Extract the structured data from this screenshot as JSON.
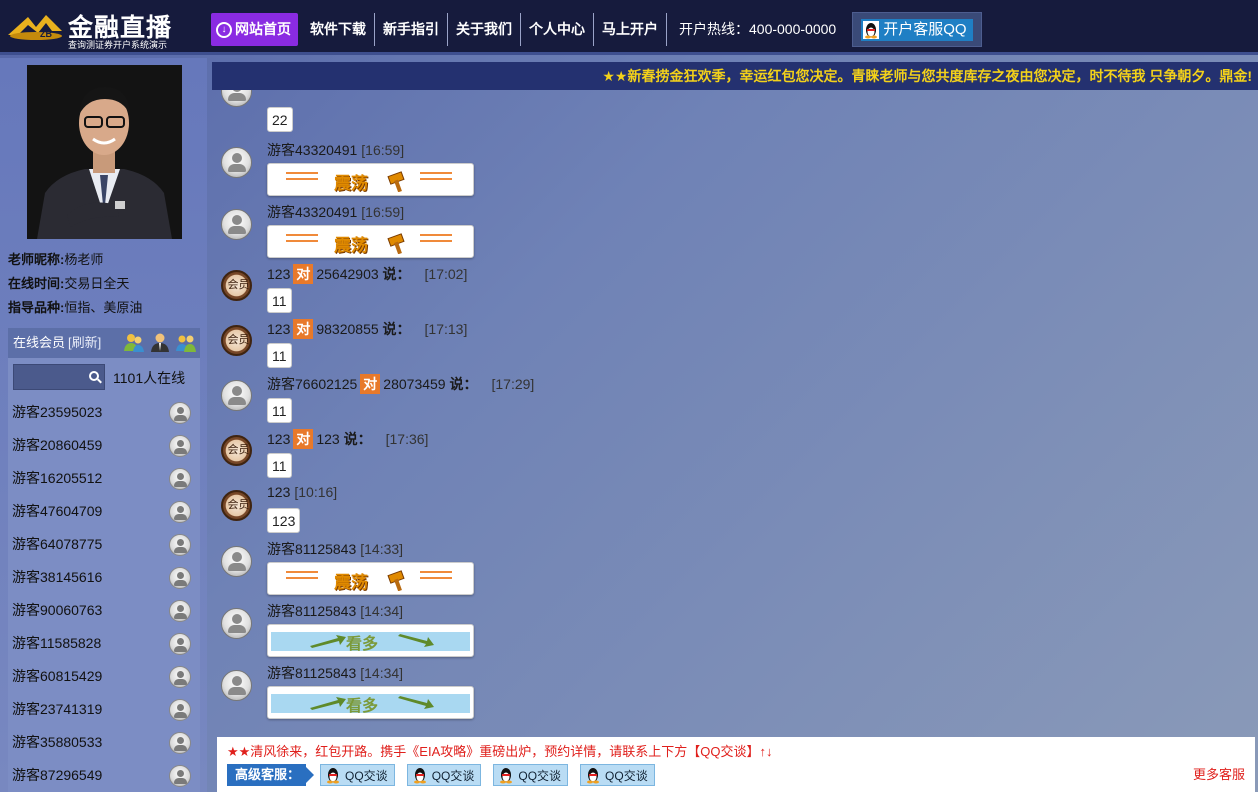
{
  "brand": {
    "title": "金融直播",
    "subtitle": "查询测证券开户系统演示"
  },
  "nav": {
    "items": [
      "网站首页",
      "软件下载",
      "新手指引",
      "关于我们",
      "个人中心",
      "马上开户"
    ],
    "hotline": "开户热线：400-000-0000",
    "qq_button": "开户客服QQ"
  },
  "teacher": {
    "nickname_label": "老师昵称:",
    "nickname": "杨老师",
    "online_label": "在线时间:",
    "online": "交易日全天",
    "products_label": "指导品种:",
    "products": "恒指、美原油"
  },
  "members": {
    "title": "在线会员",
    "refresh": "[刷新]",
    "search_placeholder": "",
    "online_count": "1101人在线",
    "list": [
      "游客23595023",
      "游客20860459",
      "游客16205512",
      "游客47604709",
      "游客64078775",
      "游客38145616",
      "游客90060763",
      "游客11585828",
      "游客60815429",
      "游客23741319",
      "游客35880533",
      "游客87296549"
    ]
  },
  "marquee": "★★新春捞金狂欢季，幸运红包您决定。青睐老师与您共度库存之夜由您决定，时不待我 只争朝夕。鼎金!",
  "chat": {
    "member_badge": "会员",
    "to_label": "对",
    "say_label": "说：",
    "messages": [
      {
        "text": "22"
      },
      {
        "user": "游客43320491",
        "time": "[16:59]",
        "sticker": "震荡"
      },
      {
        "user": "游客43320491",
        "time": "[16:59]",
        "sticker": "震荡"
      },
      {
        "user": "123",
        "target": "25642903",
        "time": "[17:02]",
        "text": "11"
      },
      {
        "user": "123",
        "target": "98320855",
        "time": "[17:13]",
        "text": "11"
      },
      {
        "user": "游客76602125",
        "target": "28073459",
        "time": "[17:29]",
        "text": "11"
      },
      {
        "user": "123",
        "target": "123",
        "time": "[17:36]",
        "text": "11"
      },
      {
        "user": "123",
        "time": "[10:16]",
        "text": "123"
      },
      {
        "user": "游客81125843",
        "time": "[14:33]",
        "sticker": "震荡"
      },
      {
        "user": "游客81125843",
        "time": "[14:34]",
        "sticker": "看多"
      },
      {
        "user": "游客81125843",
        "time": "[14:34]",
        "sticker": "看多"
      }
    ]
  },
  "bottom": {
    "notice": "★★清风徐来，红包开路。携手《EIA攻略》重磅出炉，预约详情，请联系上下方【QQ交谈】↑↓",
    "service_label": "高级客服：",
    "qq_chat": [
      "QQ交谈",
      "QQ交谈",
      "QQ交谈",
      "QQ交谈"
    ],
    "more": "更多客服"
  },
  "colors": {
    "topbar": "#161b3d",
    "home_active": "#8a2be2",
    "marquee_text": "#f3d11a",
    "to_badge": "#e8792a",
    "notice": "#e0201c"
  }
}
